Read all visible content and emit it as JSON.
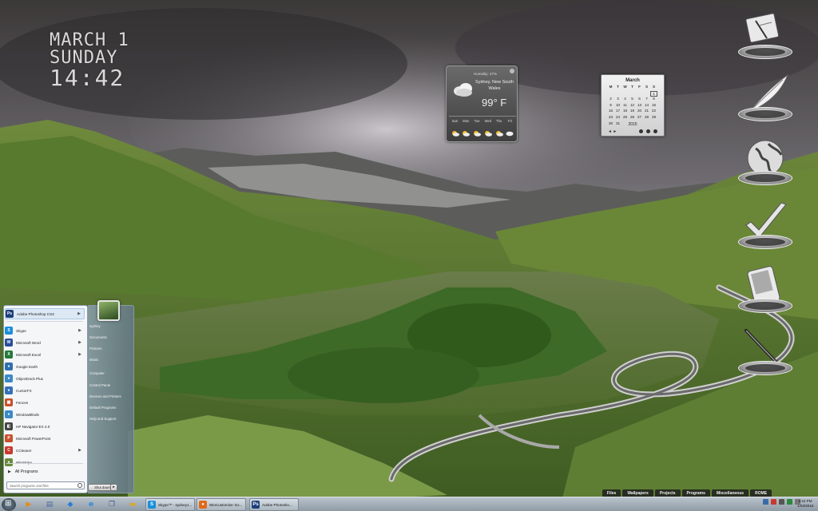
{
  "clock": {
    "date": "MARCH 1",
    "weekday": "SUNDAY",
    "time": "14:42"
  },
  "weather": {
    "humidity": "Humidity: 27%",
    "location": "Sydney, New South Wales",
    "temperature": "99° F",
    "days": [
      "Sun",
      "Mon",
      "Tue",
      "Wed",
      "Thu",
      "Fri"
    ],
    "icons": [
      "partly-sunny-icon",
      "partly-sunny-icon",
      "partly-sunny-icon",
      "partly-sunny-icon",
      "partly-sunny-icon",
      "partly-cloudy-icon"
    ]
  },
  "calendar": {
    "month": "March",
    "weekday_headers": [
      "M",
      "T",
      "W",
      "T",
      "F",
      "S",
      "S"
    ],
    "weeks": [
      [
        "",
        "",
        "",
        "",
        "",
        "",
        "1"
      ],
      [
        "2",
        "3",
        "4",
        "5",
        "6",
        "7",
        "8"
      ],
      [
        "9",
        "10",
        "11",
        "12",
        "13",
        "14",
        "15"
      ],
      [
        "16",
        "17",
        "18",
        "19",
        "20",
        "21",
        "22"
      ],
      [
        "23",
        "24",
        "25",
        "26",
        "27",
        "28",
        "29"
      ],
      [
        "30",
        "31",
        "",
        "",
        "",
        "",
        ""
      ]
    ],
    "today": "1",
    "year": "2015",
    "nav": "◄  ►"
  },
  "dock": [
    "notes-pad-icon",
    "feather-quill-icon",
    "globe-icon",
    "checkmark-icon",
    "pda-device-icon",
    "pen-icon"
  ],
  "start_menu": {
    "programs": [
      {
        "label": "Adobe Photoshop CS3",
        "icon": "Ps",
        "color": "#1e3f7a",
        "arrow": true,
        "highlight": true
      },
      {
        "label": "Skype",
        "icon": "S",
        "color": "#1a8fd8",
        "arrow": true
      },
      {
        "label": "Microsoft Word",
        "icon": "W",
        "color": "#2a4d9a",
        "arrow": true
      },
      {
        "label": "Microsoft Excel",
        "icon": "X",
        "color": "#227a3a",
        "arrow": true
      },
      {
        "label": "Google Earth",
        "icon": "●",
        "color": "#2f6fb0",
        "arrow": false
      },
      {
        "label": "ObjectDock Plus",
        "icon": "●",
        "color": "#3a8ac8",
        "arrow": false
      },
      {
        "label": "CursorFX",
        "icon": "●",
        "color": "#3571b8",
        "arrow": false
      },
      {
        "label": "Fences",
        "icon": "▦",
        "color": "#c8502a",
        "arrow": false
      },
      {
        "label": "WindowBlinds",
        "icon": "●",
        "color": "#3a8ac8",
        "arrow": false
      },
      {
        "label": "HP Navigator EX 4.0",
        "icon": "◧",
        "color": "#444444",
        "arrow": false
      },
      {
        "label": "Microsoft PowerPoint",
        "icon": "P",
        "color": "#c8502a",
        "arrow": false
      },
      {
        "label": "CCleaner",
        "icon": "C",
        "color": "#c83a2a",
        "arrow": true
      },
      {
        "label": "WinStripe",
        "icon": "●",
        "color": "#6a8a3a",
        "arrow": false
      }
    ],
    "all_programs": "All Programs",
    "search_placeholder": "Search programs and files",
    "links": [
      "sydney",
      "Documents",
      "Pictures",
      "Music",
      "Computer",
      "Control Panel",
      "Devices and Printers",
      "Default Programs",
      "Help and Support"
    ],
    "shutdown": "Shut down"
  },
  "menubar": [
    "Files",
    "Wallpapers",
    "Projects",
    "Programs",
    "Miscellaneous",
    "ROME"
  ],
  "taskbar": {
    "pinned": [
      "media-player-icon",
      "documents-icon",
      "dropbox-icon",
      "internet-explorer-icon",
      "window-switcher-icon",
      "explorer-folder-icon"
    ],
    "tasks": [
      {
        "label": "Skype™ - sydney1...",
        "icon": "S",
        "color": "#1a8fd8"
      },
      {
        "label": "WinCustomize: Ex...",
        "icon": "●",
        "color": "#e06a1a"
      },
      {
        "label": "Adobe Photosho...",
        "icon": "Ps",
        "color": "#1e3f7a"
      }
    ],
    "clock_time": "2:42 PM",
    "clock_date": "1/03/2015"
  }
}
